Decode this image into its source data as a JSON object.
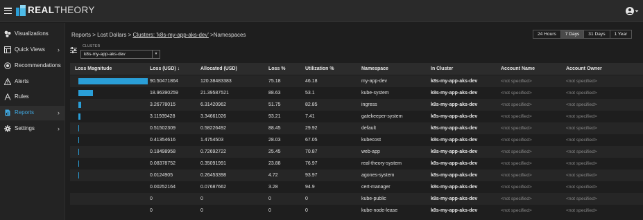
{
  "app": {
    "logo_bold": "REAL",
    "logo_thin": "THEORY"
  },
  "sidebar": {
    "items": [
      {
        "label": "Visualizations",
        "icon": "visualizations-icon",
        "chevron": "",
        "active": false
      },
      {
        "label": "Quick Views",
        "icon": "quick-views-icon",
        "chevron": "›",
        "active": false
      },
      {
        "label": "Recommendations",
        "icon": "recommendations-icon",
        "chevron": "",
        "active": false
      },
      {
        "label": "Alerts",
        "icon": "alert-icon",
        "chevron": "",
        "active": false
      },
      {
        "label": "Rules",
        "icon": "rules-icon",
        "chevron": "",
        "active": false
      },
      {
        "label": "Reports",
        "icon": "reports-icon",
        "chevron": "›",
        "active": true
      },
      {
        "label": "Settings",
        "icon": "gear-icon",
        "chevron": "›",
        "active": false
      }
    ]
  },
  "breadcrumb": {
    "part1": "Reports",
    "sep": ">",
    "part2": "Lost Dollars",
    "part3": "Clusters:",
    "part3_value": "'k8s-my-app-aks-dev'",
    "part4": "Namespaces"
  },
  "time_ranges": {
    "options": [
      "24 Hours",
      "7 Days",
      "31 Days",
      "1 Year"
    ],
    "selected": "7 Days"
  },
  "filter": {
    "label": "CLUSTER",
    "value": "k8s-my-app-aks-dev",
    "arrow": "▾"
  },
  "table": {
    "headers": [
      "Loss Magnitude",
      "Loss (USD) ↓",
      "Allocated (USD)",
      "Loss %",
      "Utilization %",
      "Namespace",
      "In Cluster",
      "Account Name",
      "Account Owner"
    ],
    "rows": [
      {
        "magnitude": 1.0,
        "loss": "90.50471864",
        "allocated": "120.38483383",
        "loss_pct": "75.18",
        "util_pct": "46.18",
        "namespace": "my-app-dev",
        "cluster": "k8s-my-app-aks-dev",
        "account_name": "<not specified>",
        "account_owner": "<not specified>"
      },
      {
        "magnitude": 0.21,
        "loss": "18.96390259",
        "allocated": "21.39587521",
        "loss_pct": "88.63",
        "util_pct": "53.1",
        "namespace": "kube-system",
        "cluster": "k8s-my-app-aks-dev",
        "account_name": "<not specified>",
        "account_owner": "<not specified>"
      },
      {
        "magnitude": 0.036,
        "loss": "3.26778015",
        "allocated": "6.31420962",
        "loss_pct": "51.75",
        "util_pct": "82.85",
        "namespace": "ingress",
        "cluster": "k8s-my-app-aks-dev",
        "account_name": "<not specified>",
        "account_owner": "<not specified>"
      },
      {
        "magnitude": 0.034,
        "loss": "3.11939428",
        "allocated": "3.34661026",
        "loss_pct": "93.21",
        "util_pct": "7.41",
        "namespace": "gatekeeper-system",
        "cluster": "k8s-my-app-aks-dev",
        "account_name": "<not specified>",
        "account_owner": "<not specified>"
      },
      {
        "magnitude": 0.0057,
        "loss": "0.51502309",
        "allocated": "0.58226492",
        "loss_pct": "88.45",
        "util_pct": "29.92",
        "namespace": "default",
        "cluster": "k8s-my-app-aks-dev",
        "account_name": "<not specified>",
        "account_owner": "<not specified>"
      },
      {
        "magnitude": 0.0046,
        "loss": "0.41354616",
        "allocated": "1.4754503",
        "loss_pct": "28.03",
        "util_pct": "67.05",
        "namespace": "kubecost",
        "cluster": "k8s-my-app-aks-dev",
        "account_name": "<not specified>",
        "account_owner": "<not specified>"
      },
      {
        "magnitude": 0.002,
        "loss": "0.18498958",
        "allocated": "0.72692722",
        "loss_pct": "25.45",
        "util_pct": "70.87",
        "namespace": "web-app",
        "cluster": "k8s-my-app-aks-dev",
        "account_name": "<not specified>",
        "account_owner": "<not specified>"
      },
      {
        "magnitude": 0.0009,
        "loss": "0.08378752",
        "allocated": "0.35091991",
        "loss_pct": "23.88",
        "util_pct": "76.97",
        "namespace": "real-theory-system",
        "cluster": "k8s-my-app-aks-dev",
        "account_name": "<not specified>",
        "account_owner": "<not specified>"
      },
      {
        "magnitude": 0.0001,
        "loss": "0.0124905",
        "allocated": "0.26453398",
        "loss_pct": "4.72",
        "util_pct": "93.97",
        "namespace": "agones-system",
        "cluster": "k8s-my-app-aks-dev",
        "account_name": "<not specified>",
        "account_owner": "<not specified>"
      },
      {
        "magnitude": 0.0,
        "loss": "0.00252164",
        "allocated": "0.07687662",
        "loss_pct": "3.28",
        "util_pct": "94.9",
        "namespace": "cert-manager",
        "cluster": "k8s-my-app-aks-dev",
        "account_name": "<not specified>",
        "account_owner": "<not specified>"
      },
      {
        "magnitude": 0.0,
        "loss": "0",
        "allocated": "0",
        "loss_pct": "0",
        "util_pct": "0",
        "namespace": "kube-public",
        "cluster": "k8s-my-app-aks-dev",
        "account_name": "<not specified>",
        "account_owner": "<not specified>"
      },
      {
        "magnitude": 0.0,
        "loss": "0",
        "allocated": "0",
        "loss_pct": "0",
        "util_pct": "0",
        "namespace": "kube-node-lease",
        "cluster": "k8s-my-app-aks-dev",
        "account_name": "<not specified>",
        "account_owner": "<not specified>"
      }
    ]
  },
  "colors": {
    "accent": "#2a9fd8",
    "active_nav": "#3fa7e0",
    "background": "#1e1e1e"
  }
}
